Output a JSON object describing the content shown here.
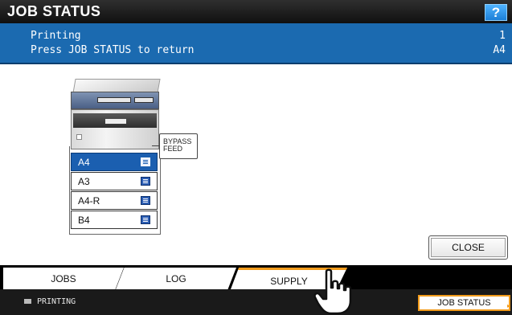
{
  "title": "JOB STATUS",
  "help_label": "?",
  "message": {
    "line1": "Printing",
    "line2": "Press JOB STATUS to return",
    "right1": "1",
    "right2": "A4"
  },
  "trays": [
    {
      "label": "A4",
      "selected": true
    },
    {
      "label": "A3",
      "selected": false
    },
    {
      "label": "A4-R",
      "selected": false
    },
    {
      "label": "B4",
      "selected": false
    }
  ],
  "bypass": {
    "line1": "BYPASS",
    "line2": "FEED"
  },
  "close_label": "CLOSE",
  "tabs": [
    {
      "label": "JOBS",
      "active": false
    },
    {
      "label": "LOG",
      "active": false
    },
    {
      "label": "SUPPLY",
      "active": true
    }
  ],
  "status": {
    "icon": "printer-icon",
    "text": "PRINTING",
    "job_status_label": "JOB STATUS"
  },
  "colors": {
    "accent_blue": "#1b6ab0",
    "tab_highlight": "#f29b1b"
  }
}
